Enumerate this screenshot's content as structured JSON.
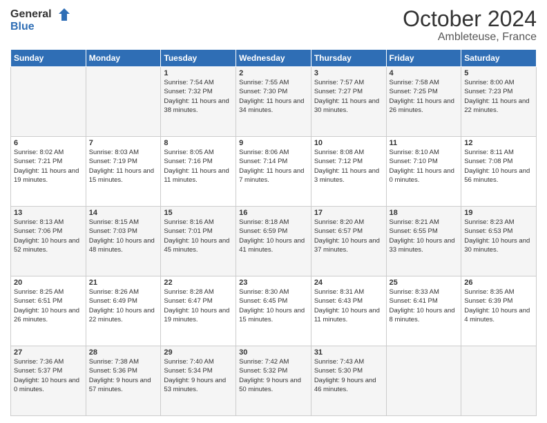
{
  "logo": {
    "line1": "General",
    "line2": "Blue"
  },
  "header": {
    "month": "October 2024",
    "location": "Ambleteuse, France"
  },
  "weekdays": [
    "Sunday",
    "Monday",
    "Tuesday",
    "Wednesday",
    "Thursday",
    "Friday",
    "Saturday"
  ],
  "weeks": [
    [
      {
        "day": "",
        "detail": ""
      },
      {
        "day": "",
        "detail": ""
      },
      {
        "day": "1",
        "detail": "Sunrise: 7:54 AM\nSunset: 7:32 PM\nDaylight: 11 hours and 38 minutes."
      },
      {
        "day": "2",
        "detail": "Sunrise: 7:55 AM\nSunset: 7:30 PM\nDaylight: 11 hours and 34 minutes."
      },
      {
        "day": "3",
        "detail": "Sunrise: 7:57 AM\nSunset: 7:27 PM\nDaylight: 11 hours and 30 minutes."
      },
      {
        "day": "4",
        "detail": "Sunrise: 7:58 AM\nSunset: 7:25 PM\nDaylight: 11 hours and 26 minutes."
      },
      {
        "day": "5",
        "detail": "Sunrise: 8:00 AM\nSunset: 7:23 PM\nDaylight: 11 hours and 22 minutes."
      }
    ],
    [
      {
        "day": "6",
        "detail": "Sunrise: 8:02 AM\nSunset: 7:21 PM\nDaylight: 11 hours and 19 minutes."
      },
      {
        "day": "7",
        "detail": "Sunrise: 8:03 AM\nSunset: 7:19 PM\nDaylight: 11 hours and 15 minutes."
      },
      {
        "day": "8",
        "detail": "Sunrise: 8:05 AM\nSunset: 7:16 PM\nDaylight: 11 hours and 11 minutes."
      },
      {
        "day": "9",
        "detail": "Sunrise: 8:06 AM\nSunset: 7:14 PM\nDaylight: 11 hours and 7 minutes."
      },
      {
        "day": "10",
        "detail": "Sunrise: 8:08 AM\nSunset: 7:12 PM\nDaylight: 11 hours and 3 minutes."
      },
      {
        "day": "11",
        "detail": "Sunrise: 8:10 AM\nSunset: 7:10 PM\nDaylight: 11 hours and 0 minutes."
      },
      {
        "day": "12",
        "detail": "Sunrise: 8:11 AM\nSunset: 7:08 PM\nDaylight: 10 hours and 56 minutes."
      }
    ],
    [
      {
        "day": "13",
        "detail": "Sunrise: 8:13 AM\nSunset: 7:06 PM\nDaylight: 10 hours and 52 minutes."
      },
      {
        "day": "14",
        "detail": "Sunrise: 8:15 AM\nSunset: 7:03 PM\nDaylight: 10 hours and 48 minutes."
      },
      {
        "day": "15",
        "detail": "Sunrise: 8:16 AM\nSunset: 7:01 PM\nDaylight: 10 hours and 45 minutes."
      },
      {
        "day": "16",
        "detail": "Sunrise: 8:18 AM\nSunset: 6:59 PM\nDaylight: 10 hours and 41 minutes."
      },
      {
        "day": "17",
        "detail": "Sunrise: 8:20 AM\nSunset: 6:57 PM\nDaylight: 10 hours and 37 minutes."
      },
      {
        "day": "18",
        "detail": "Sunrise: 8:21 AM\nSunset: 6:55 PM\nDaylight: 10 hours and 33 minutes."
      },
      {
        "day": "19",
        "detail": "Sunrise: 8:23 AM\nSunset: 6:53 PM\nDaylight: 10 hours and 30 minutes."
      }
    ],
    [
      {
        "day": "20",
        "detail": "Sunrise: 8:25 AM\nSunset: 6:51 PM\nDaylight: 10 hours and 26 minutes."
      },
      {
        "day": "21",
        "detail": "Sunrise: 8:26 AM\nSunset: 6:49 PM\nDaylight: 10 hours and 22 minutes."
      },
      {
        "day": "22",
        "detail": "Sunrise: 8:28 AM\nSunset: 6:47 PM\nDaylight: 10 hours and 19 minutes."
      },
      {
        "day": "23",
        "detail": "Sunrise: 8:30 AM\nSunset: 6:45 PM\nDaylight: 10 hours and 15 minutes."
      },
      {
        "day": "24",
        "detail": "Sunrise: 8:31 AM\nSunset: 6:43 PM\nDaylight: 10 hours and 11 minutes."
      },
      {
        "day": "25",
        "detail": "Sunrise: 8:33 AM\nSunset: 6:41 PM\nDaylight: 10 hours and 8 minutes."
      },
      {
        "day": "26",
        "detail": "Sunrise: 8:35 AM\nSunset: 6:39 PM\nDaylight: 10 hours and 4 minutes."
      }
    ],
    [
      {
        "day": "27",
        "detail": "Sunrise: 7:36 AM\nSunset: 5:37 PM\nDaylight: 10 hours and 0 minutes."
      },
      {
        "day": "28",
        "detail": "Sunrise: 7:38 AM\nSunset: 5:36 PM\nDaylight: 9 hours and 57 minutes."
      },
      {
        "day": "29",
        "detail": "Sunrise: 7:40 AM\nSunset: 5:34 PM\nDaylight: 9 hours and 53 minutes."
      },
      {
        "day": "30",
        "detail": "Sunrise: 7:42 AM\nSunset: 5:32 PM\nDaylight: 9 hours and 50 minutes."
      },
      {
        "day": "31",
        "detail": "Sunrise: 7:43 AM\nSunset: 5:30 PM\nDaylight: 9 hours and 46 minutes."
      },
      {
        "day": "",
        "detail": ""
      },
      {
        "day": "",
        "detail": ""
      }
    ]
  ]
}
